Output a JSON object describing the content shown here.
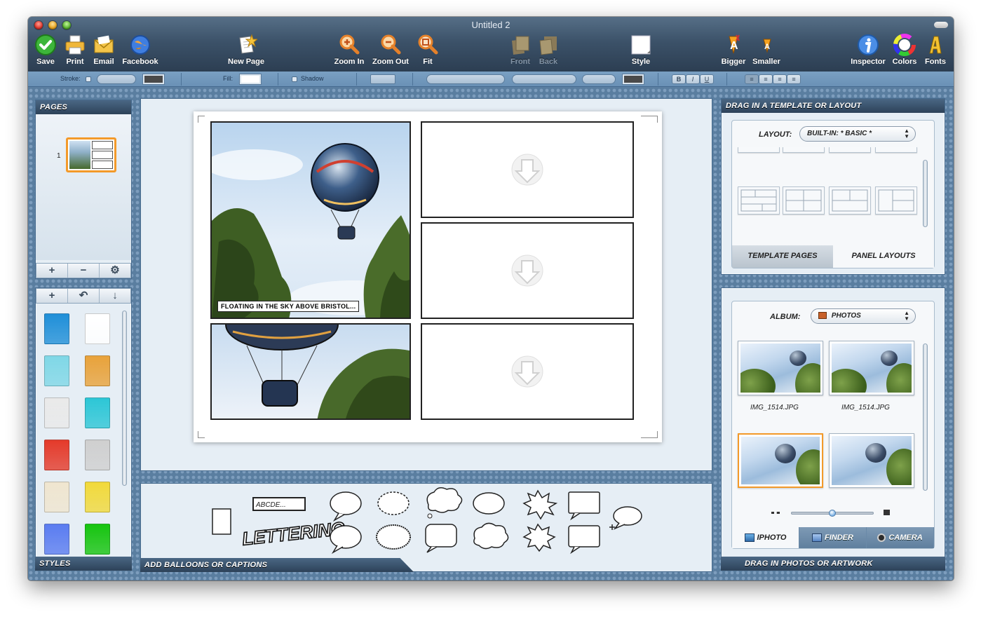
{
  "window": {
    "title": "Untitled 2"
  },
  "toolbar": {
    "save": "Save",
    "print": "Print",
    "email": "Email",
    "facebook": "Facebook",
    "new_page": "New Page",
    "zoom_in": "Zoom In",
    "zoom_out": "Zoom Out",
    "fit": "Fit",
    "front": "Front",
    "back": "Back",
    "style": "Style",
    "bigger": "Bigger",
    "smaller": "Smaller",
    "inspector": "Inspector",
    "colors": "Colors",
    "fonts": "Fonts"
  },
  "formatbar": {
    "stroke": "Stroke:",
    "fill": "Fill:",
    "shadow": "Shadow",
    "bold": "B",
    "italic": "I",
    "underline": "U"
  },
  "pages": {
    "title": "Pages",
    "page_number": "1",
    "add": "+",
    "remove": "−",
    "settings": "⚙"
  },
  "styles": {
    "title": "Styles",
    "add": "+",
    "revert": "↶",
    "apply": "↓",
    "colors": [
      "#1f8fd8",
      "#ffffff",
      "#7fd7e6",
      "#e8a23a",
      "#e9e9e9",
      "#2cc6d6",
      "#e43a2a",
      "#cfcfcf",
      "#efe5cf",
      "#f1d93a",
      "#5a7cf0",
      "#16c40f"
    ]
  },
  "canvas": {
    "caption": "FLOATING IN THE SKY ABOVE BRISTOL..."
  },
  "balloons": {
    "footer": "Add balloons or captions",
    "caption_sample": "ABCDE...",
    "lettering": "LETTERING"
  },
  "templates": {
    "header": "Drag in a template or layout",
    "layout_label": "Layout:",
    "layout_value": "Built-in: * Basic *",
    "tab_template_pages": "Template Pages",
    "tab_panel_layouts": "Panel Layouts"
  },
  "photos": {
    "album_label": "Album:",
    "album_value": "Photos",
    "files": [
      "IMG_1514.JPG",
      "IMG_1514.JPG"
    ],
    "footer": "Drag in photos or artwork",
    "tab_iphoto": "iPhoto",
    "tab_finder": "Finder",
    "tab_camera": "Camera",
    "thumb_size_fraction": 0.5
  }
}
